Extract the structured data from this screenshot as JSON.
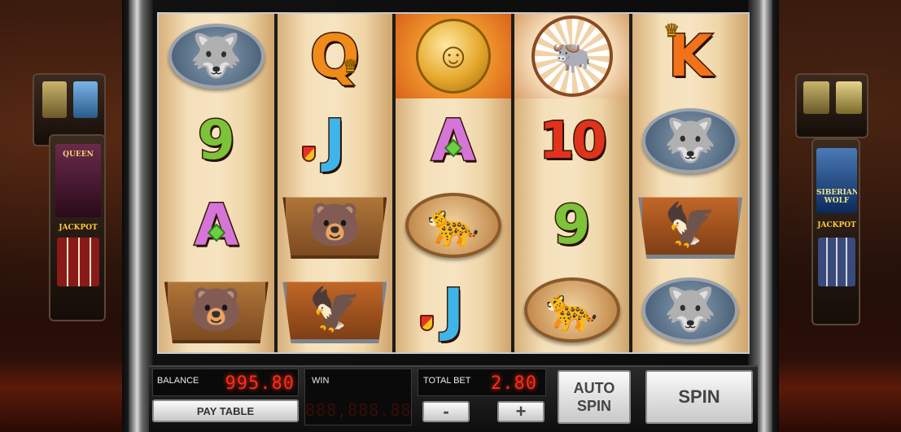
{
  "reels": [
    [
      {
        "symbol": "wolf",
        "kind": "medal",
        "icon": "🐺"
      },
      {
        "symbol": "9",
        "kind": "nine"
      },
      {
        "symbol": "A",
        "kind": "ace"
      },
      {
        "symbol": "bear",
        "kind": "frame",
        "icon": "🐻"
      }
    ],
    [
      {
        "symbol": "Q",
        "kind": "queen"
      },
      {
        "symbol": "J",
        "kind": "jack"
      },
      {
        "symbol": "bear",
        "kind": "frame",
        "icon": "🐻"
      },
      {
        "symbol": "eagle",
        "kind": "frame-steel",
        "icon": "🦅"
      }
    ],
    [
      {
        "symbol": "gold-coin",
        "kind": "coin",
        "icon": "☺"
      },
      {
        "symbol": "A",
        "kind": "ace"
      },
      {
        "symbol": "cougar",
        "kind": "medal-cougar",
        "icon": "🐆"
      },
      {
        "symbol": "J",
        "kind": "jack"
      }
    ],
    [
      {
        "symbol": "dreamcatcher-buffalo",
        "kind": "dreamcatcher",
        "icon": "🐃"
      },
      {
        "symbol": "10",
        "kind": "ten"
      },
      {
        "symbol": "9",
        "kind": "nine"
      },
      {
        "symbol": "cougar",
        "kind": "medal-cougar",
        "icon": "🐆"
      }
    ],
    [
      {
        "symbol": "K",
        "kind": "king"
      },
      {
        "symbol": "wolf",
        "kind": "medal",
        "icon": "🐺"
      },
      {
        "symbol": "eagle",
        "kind": "frame-steel",
        "icon": "🦅"
      },
      {
        "symbol": "wolf",
        "kind": "medal",
        "icon": "🐺"
      }
    ]
  ],
  "panel": {
    "balance_label": "BALANCE",
    "balance_value": "995.80",
    "win_label": "WIN",
    "win_value": "888,888.88",
    "total_bet_label": "TOTAL BET",
    "total_bet_value": "2.80",
    "pay_table_label": "PAY TABLE",
    "minus_label": "-",
    "plus_label": "+",
    "auto_spin_label_1": "AUTO",
    "auto_spin_label_2": "SPIN",
    "spin_label": "SPIN"
  },
  "side_machines": {
    "left_logo": "QUEEN",
    "left_jackpot": "JACKPOT",
    "right_logo": "SIBERIAN WOLF",
    "right_jackpot": "JACKPOT"
  },
  "colors": {
    "led": "#ff2a1a",
    "reel_bg": "#f6e4c2"
  }
}
